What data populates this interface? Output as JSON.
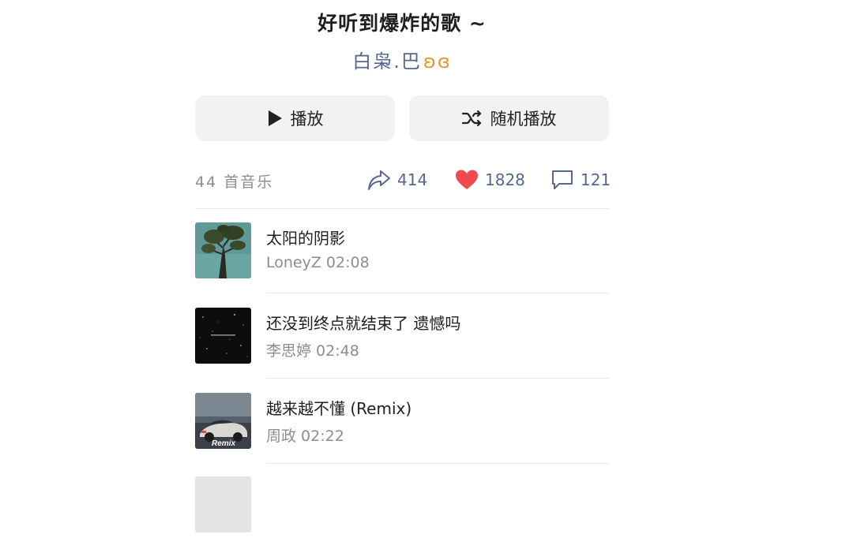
{
  "playlist": {
    "title": "好听到爆炸的歌 ~",
    "author": "白枭.巴",
    "author_emoji": "ʚɞ"
  },
  "actions": {
    "play_label": "播放",
    "shuffle_label": "随机播放"
  },
  "stats": {
    "count_label": "44 首音乐",
    "shares": "414",
    "likes": "1828",
    "comments": "121"
  },
  "songs": [
    {
      "name": "太阳的阴影",
      "meta": "LoneyZ 02:08",
      "cover": "tree-sky-cover"
    },
    {
      "name": "还没到终点就结束了  遗憾吗",
      "meta": "李思婷  02:48",
      "cover": "starry-black-cover"
    },
    {
      "name": "越来越不懂 (Remix)",
      "meta": "周政  02:22",
      "cover": "remix-car-cover",
      "cover_text": "Remix"
    }
  ],
  "colors": {
    "accent_blue": "#55688f",
    "like_red": "#f04a4e",
    "button_bg": "#f2f2f2"
  }
}
